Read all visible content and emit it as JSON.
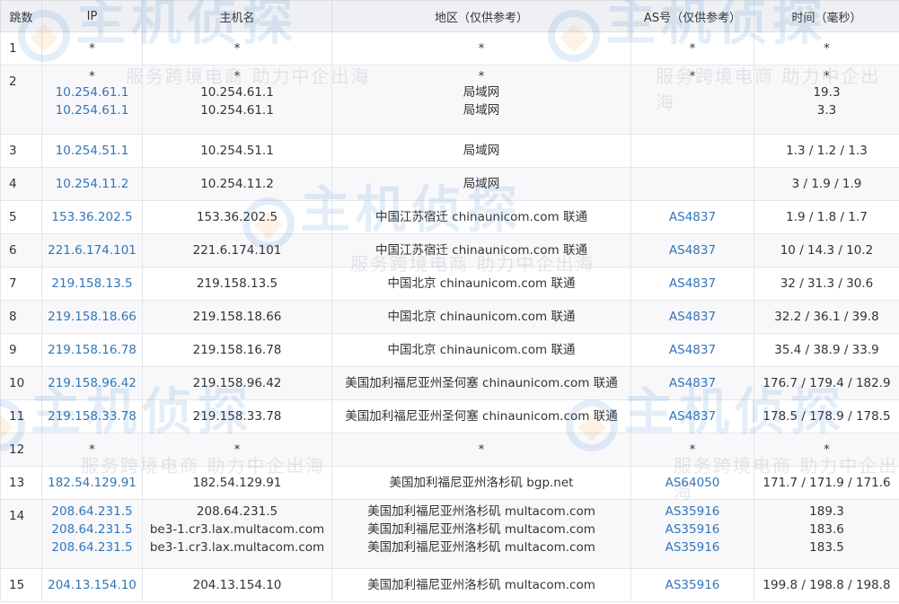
{
  "headers": [
    "跳数",
    "IP",
    "主机名",
    "地区（仅供参考）",
    "AS号（仅供参考）",
    "时间（毫秒）"
  ],
  "watermark": {
    "logo_text": "主机侦探",
    "slogan": "服务跨境电商 助力中企出海"
  },
  "hops": [
    {
      "hop": "1",
      "ips": [
        "*"
      ],
      "hosts": [
        "*"
      ],
      "regions": [
        "*"
      ],
      "asns": [
        "*"
      ],
      "times": [
        "*"
      ]
    },
    {
      "hop": "2",
      "ips": [
        "*",
        "10.254.61.1",
        "10.254.61.1"
      ],
      "hosts": [
        "*",
        "10.254.61.1",
        "10.254.61.1"
      ],
      "regions": [
        "*",
        "局域网",
        "局域网"
      ],
      "asns": [
        "*"
      ],
      "times": [
        "*",
        "19.3",
        "3.3"
      ]
    },
    {
      "hop": "3",
      "ips": [
        "10.254.51.1"
      ],
      "hosts": [
        "10.254.51.1"
      ],
      "regions": [
        "局域网"
      ],
      "asns": [],
      "times": [
        "1.3 / 1.2 / 1.3"
      ]
    },
    {
      "hop": "4",
      "ips": [
        "10.254.11.2"
      ],
      "hosts": [
        "10.254.11.2"
      ],
      "regions": [
        "局域网"
      ],
      "asns": [],
      "times": [
        "3 / 1.9 / 1.9"
      ]
    },
    {
      "hop": "5",
      "ips": [
        "153.36.202.5"
      ],
      "hosts": [
        "153.36.202.5"
      ],
      "regions": [
        "中国江苏宿迁 chinaunicom.com 联通"
      ],
      "asns": [
        "AS4837"
      ],
      "times": [
        "1.9 / 1.8 / 1.7"
      ]
    },
    {
      "hop": "6",
      "ips": [
        "221.6.174.101"
      ],
      "hosts": [
        "221.6.174.101"
      ],
      "regions": [
        "中国江苏宿迁 chinaunicom.com 联通"
      ],
      "asns": [
        "AS4837"
      ],
      "times": [
        "10 / 14.3 / 10.2"
      ]
    },
    {
      "hop": "7",
      "ips": [
        "219.158.13.5"
      ],
      "hosts": [
        "219.158.13.5"
      ],
      "regions": [
        "中国北京 chinaunicom.com 联通"
      ],
      "asns": [
        "AS4837"
      ],
      "times": [
        "32 / 31.3 / 30.6"
      ]
    },
    {
      "hop": "8",
      "ips": [
        "219.158.18.66"
      ],
      "hosts": [
        "219.158.18.66"
      ],
      "regions": [
        "中国北京 chinaunicom.com 联通"
      ],
      "asns": [
        "AS4837"
      ],
      "times": [
        "32.2 / 36.1 / 39.8"
      ]
    },
    {
      "hop": "9",
      "ips": [
        "219.158.16.78"
      ],
      "hosts": [
        "219.158.16.78"
      ],
      "regions": [
        "中国北京 chinaunicom.com 联通"
      ],
      "asns": [
        "AS4837"
      ],
      "times": [
        "35.4 / 38.9 / 33.9"
      ]
    },
    {
      "hop": "10",
      "ips": [
        "219.158.96.42"
      ],
      "hosts": [
        "219.158.96.42"
      ],
      "regions": [
        "美国加利福尼亚州圣何塞 chinaunicom.com 联通"
      ],
      "asns": [
        "AS4837"
      ],
      "times": [
        "176.7 / 179.4 / 182.9"
      ]
    },
    {
      "hop": "11",
      "ips": [
        "219.158.33.78"
      ],
      "hosts": [
        "219.158.33.78"
      ],
      "regions": [
        "美国加利福尼亚州圣何塞 chinaunicom.com 联通"
      ],
      "asns": [
        "AS4837"
      ],
      "times": [
        "178.5 / 178.9 / 178.5"
      ]
    },
    {
      "hop": "12",
      "ips": [
        "*"
      ],
      "hosts": [
        "*"
      ],
      "regions": [
        "*"
      ],
      "asns": [
        "*"
      ],
      "times": [
        "*"
      ]
    },
    {
      "hop": "13",
      "ips": [
        "182.54.129.91"
      ],
      "hosts": [
        "182.54.129.91"
      ],
      "regions": [
        "美国加利福尼亚州洛杉矶 bgp.net"
      ],
      "asns": [
        "AS64050"
      ],
      "times": [
        "171.7 / 171.9 / 171.6"
      ]
    },
    {
      "hop": "14",
      "ips": [
        "208.64.231.5",
        "208.64.231.5",
        "208.64.231.5"
      ],
      "hosts": [
        "208.64.231.5",
        "be3-1.cr3.lax.multacom.com",
        "be3-1.cr3.lax.multacom.com"
      ],
      "regions": [
        "美国加利福尼亚州洛杉矶 multacom.com",
        "美国加利福尼亚州洛杉矶 multacom.com",
        "美国加利福尼亚州洛杉矶 multacom.com"
      ],
      "asns": [
        "AS35916",
        "AS35916",
        "AS35916"
      ],
      "times": [
        "189.3",
        "183.6",
        "183.5"
      ]
    },
    {
      "hop": "15",
      "ips": [
        "204.13.154.10"
      ],
      "hosts": [
        "204.13.154.10"
      ],
      "regions": [
        "美国加利福尼亚州洛杉矶 multacom.com"
      ],
      "asns": [
        "AS35916"
      ],
      "times": [
        "199.8 / 198.8 / 198.8"
      ]
    }
  ]
}
